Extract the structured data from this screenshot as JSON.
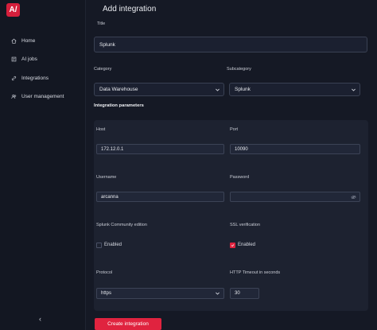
{
  "app": {
    "logo_text": "A/"
  },
  "sidebar": {
    "items": [
      {
        "label": "Home",
        "icon": "home-icon"
      },
      {
        "label": "AI jobs",
        "icon": "ai-jobs-icon"
      },
      {
        "label": "Integrations",
        "icon": "link-icon"
      },
      {
        "label": "User management",
        "icon": "users-icon"
      }
    ],
    "collapse_glyph": "‹"
  },
  "page": {
    "title": "Add integration"
  },
  "form": {
    "title_label": "Title",
    "title_value": "Splunk",
    "category_label": "Category",
    "category_value": "Data Warehouse",
    "subcategory_label": "Subcategory",
    "subcategory_value": "Splunk",
    "params_title": "Integration parameters",
    "host_label": "Host",
    "host_value": "172.12.0.1",
    "port_label": "Port",
    "port_value": "10090",
    "username_label": "Username",
    "username_value": "arcanna",
    "password_label": "Password",
    "password_value": "",
    "community_label": "Splunk Community edition",
    "community_checkbox_label": "Enabled",
    "community_checked": false,
    "ssl_label": "SSL verification",
    "ssl_checkbox_label": "Enabled",
    "ssl_checked": true,
    "protocol_label": "Protocol",
    "protocol_value": "https",
    "timeout_label": "HTTP Timeout in seconds",
    "timeout_value": "30",
    "create_button": "Create integration"
  },
  "colors": {
    "accent": "#e0233f",
    "background": "#151925",
    "panel": "#1d2230"
  }
}
